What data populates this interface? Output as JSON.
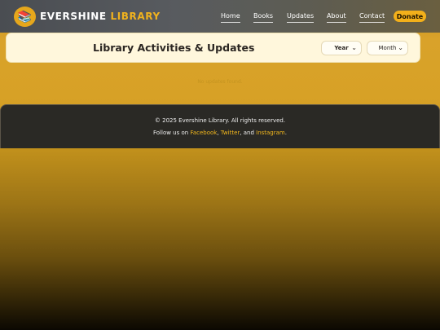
{
  "header": {
    "logo_icon": "books-icon",
    "brand_part1": "EVERSHINE",
    "brand_part2": "LIBRARY",
    "nav": [
      "Home",
      "Books",
      "Updates",
      "About",
      "Contact"
    ],
    "donate_label": "Donate"
  },
  "main": {
    "title": "Library Activities & Updates",
    "year_select": "Year",
    "month_select": "Month",
    "status": "No updates found."
  },
  "footer": {
    "copyright": "© 2025 Evershine Library. All rights reserved.",
    "follow_prefix": "Follow us on",
    "facebook": "Facebook",
    "comma": ",",
    "twitter": "Twitter",
    "and": ", and",
    "instagram": "Instagram",
    "period": "."
  },
  "colors": {
    "accent": "#f3b01a",
    "header_bg": "#55585c",
    "footer_bg": "#2a2925",
    "card_bg": "#fff7dc"
  }
}
